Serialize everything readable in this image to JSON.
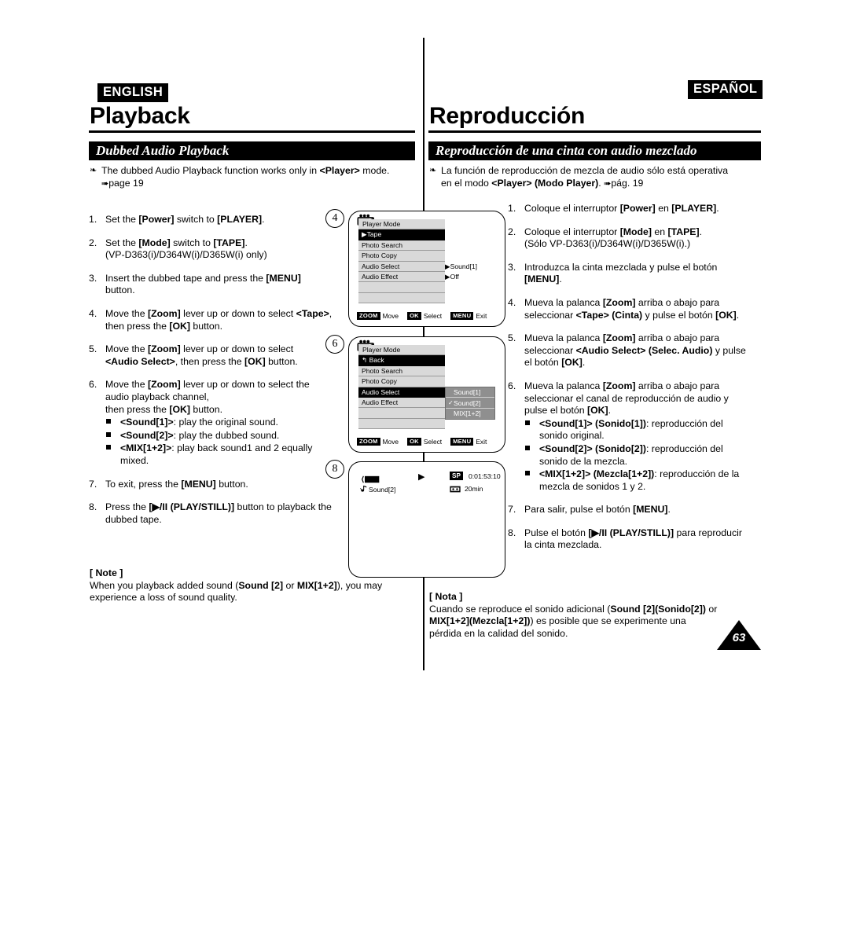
{
  "page_number": "63",
  "english": {
    "lang_tag": "ENGLISH",
    "chapter_title": "Playback",
    "section_title": "Dubbed Audio Playback",
    "intro": {
      "text": "The dubbed Audio Playback function works only in ",
      "bold": "<Player>",
      "text2": " mode.",
      "ref": "page 19"
    },
    "steps": [
      {
        "num": "1.",
        "html": "Set the <b>[Power]</b> switch to <b>[PLAYER]</b>."
      },
      {
        "num": "2.",
        "html": "Set the <b>[Mode]</b> switch to <b>[TAPE]</b>.<br>(VP-D363(i)/D364W(i)/D365W(i) only)"
      },
      {
        "num": "3.",
        "html": "Insert the dubbed tape and press the <b>[MENU]</b> button."
      },
      {
        "num": "4.",
        "html": "Move the <b>[Zoom]</b> lever up or down to select <b>&lt;Tape&gt;</b>,<br>then press the <b>[OK]</b> button."
      },
      {
        "num": "5.",
        "html": "Move the <b>[Zoom]</b> lever up or down to select<br><b>&lt;Audio Select&gt;</b>, then press the <b>[OK]</b> button."
      },
      {
        "num": "6.",
        "html": "Move the <b>[Zoom]</b> lever up or down to select the<br>audio playback channel,<br>then press the <b>[OK]</b> button."
      },
      {
        "num": "7.",
        "html": "To exit, press the <b>[MENU]</b> button."
      },
      {
        "num": "8.",
        "html": "Press the <b>[&#9654;/II (PLAY/STILL)]</b> button to playback the<br>dubbed tape."
      }
    ],
    "substeps": [
      "<b>&lt;Sound[1]&gt;</b>: play the original sound.",
      "<b>&lt;Sound[2]&gt;</b>: play the dubbed sound.",
      "<b>&lt;MIX[1+2]&gt;</b>: play back sound1 and 2 equally<br>mixed."
    ],
    "note": {
      "title": "[ Note ]",
      "html": "When you playback added sound (<b>Sound [2]</b> or <b>MIX[1+2]</b>), you may<br>experience a loss of sound quality."
    }
  },
  "spanish": {
    "lang_tag": "ESPAÑOL",
    "chapter_title": "Reproducción",
    "section_title": "Reproducción de una cinta con audio mezclado",
    "intro": {
      "text": "La función de reproducción de mezcla de audio sólo está operativa",
      "text2": "en el modo ",
      "bold": "<Player> (Modo Player)",
      "text3": ". ",
      "ref": "pág. 19"
    },
    "steps": [
      {
        "num": "1.",
        "html": "Coloque el interruptor <b>[Power]</b> en <b>[PLAYER]</b>."
      },
      {
        "num": "2.",
        "html": "Coloque el interruptor <b>[Mode]</b> en <b>[TAPE]</b>.<br>(Sólo VP-D363(i)/D364W(i)/D365W(i).)"
      },
      {
        "num": "3.",
        "html": "Introduzca la cinta mezclada y pulse el botón<br><b>[MENU]</b>."
      },
      {
        "num": "4.",
        "html": "Mueva la palanca <b>[Zoom]</b> arriba o abajo para<br>seleccionar <b>&lt;Tape&gt; (Cinta)</b> y pulse el botón <b>[OK]</b>."
      },
      {
        "num": "5.",
        "html": "Mueva la palanca <b>[Zoom]</b> arriba o abajo para<br>seleccionar <b>&lt;Audio Select&gt; (Selec. Audio)</b> y pulse<br>el botón <b>[OK]</b>."
      },
      {
        "num": "6.",
        "html": "Mueva la palanca <b>[Zoom]</b> arriba o abajo para<br>seleccionar el canal de reproducción de audio y<br>pulse el botón <b>[OK]</b>."
      },
      {
        "num": "7.",
        "html": "Para salir, pulse el botón <b>[MENU]</b>."
      },
      {
        "num": "8.",
        "html": "Pulse el botón <b>[&#9654;/II (PLAY/STILL)]</b> para reproducir<br>la cinta mezclada."
      }
    ],
    "substeps": [
      "<b>&lt;Sound[1]&gt; (Sonido[1])</b>: reproducción del<br>sonido original.",
      "<b>&lt;Sound[2]&gt; (Sonido[2])</b>: reproducción del<br>sonido de la mezcla.",
      "<b>&lt;MIX[1+2]&gt; (Mezcla[1+2])</b>: reproducción de la<br>mezcla de sonidos 1 y 2."
    ],
    "note": {
      "title": "[ Nota ]",
      "html": "Cuando se reproduce el sonido adicional (<b>Sound [2](Sonido[2])</b> or<br><b>MIX[1+2](Mezcla[1+2])</b>) es posible que se experimente una<br>pérdida en la calidad del sonido."
    }
  },
  "step_circles": [
    "4",
    "6",
    "8"
  ],
  "lcd_screens": [
    {
      "id": "lcd-menu-tape",
      "header": "Player Mode",
      "rows": [
        {
          "label": "▶Tape",
          "highlight": true,
          "value": ""
        },
        {
          "label": "Photo Search",
          "highlight": false,
          "value": ""
        },
        {
          "label": "Photo Copy",
          "highlight": false,
          "value": ""
        },
        {
          "label": "Audio Select",
          "highlight": false,
          "value": "▶Sound[1]"
        },
        {
          "label": "Audio Effect",
          "highlight": false,
          "value": "▶Off"
        }
      ],
      "guide": [
        {
          "key": "ZOOM",
          "label": "Move"
        },
        {
          "key": "OK",
          "label": "Select"
        },
        {
          "key": "MENU",
          "label": "Exit"
        }
      ]
    },
    {
      "id": "lcd-menu-audio-select",
      "header": "Player Mode",
      "rows": [
        {
          "label": "↰ Back",
          "highlight": true,
          "value": ""
        },
        {
          "label": "Photo Search",
          "highlight": false,
          "value": ""
        },
        {
          "label": "Photo Copy",
          "highlight": false,
          "value": ""
        },
        {
          "label": "Audio Select",
          "highlight": true,
          "value": ""
        },
        {
          "label": "Audio Effect",
          "highlight": false,
          "value": ""
        }
      ],
      "submenu": [
        {
          "label": "Sound[1]",
          "checked": false
        },
        {
          "label": "Sound[2]",
          "checked": true
        },
        {
          "label": "MIX[1+2]",
          "checked": false
        }
      ],
      "guide": [
        {
          "key": "ZOOM",
          "label": "Move"
        },
        {
          "key": "OK",
          "label": "Select"
        },
        {
          "key": "MENU",
          "label": "Exit"
        }
      ]
    },
    {
      "id": "lcd-playback-status",
      "play_indicator": "▶",
      "record_mode": "SP",
      "timecode": "0:01:53:10",
      "sound_mode": "Sound[2]",
      "tape_remaining": "20min"
    }
  ]
}
